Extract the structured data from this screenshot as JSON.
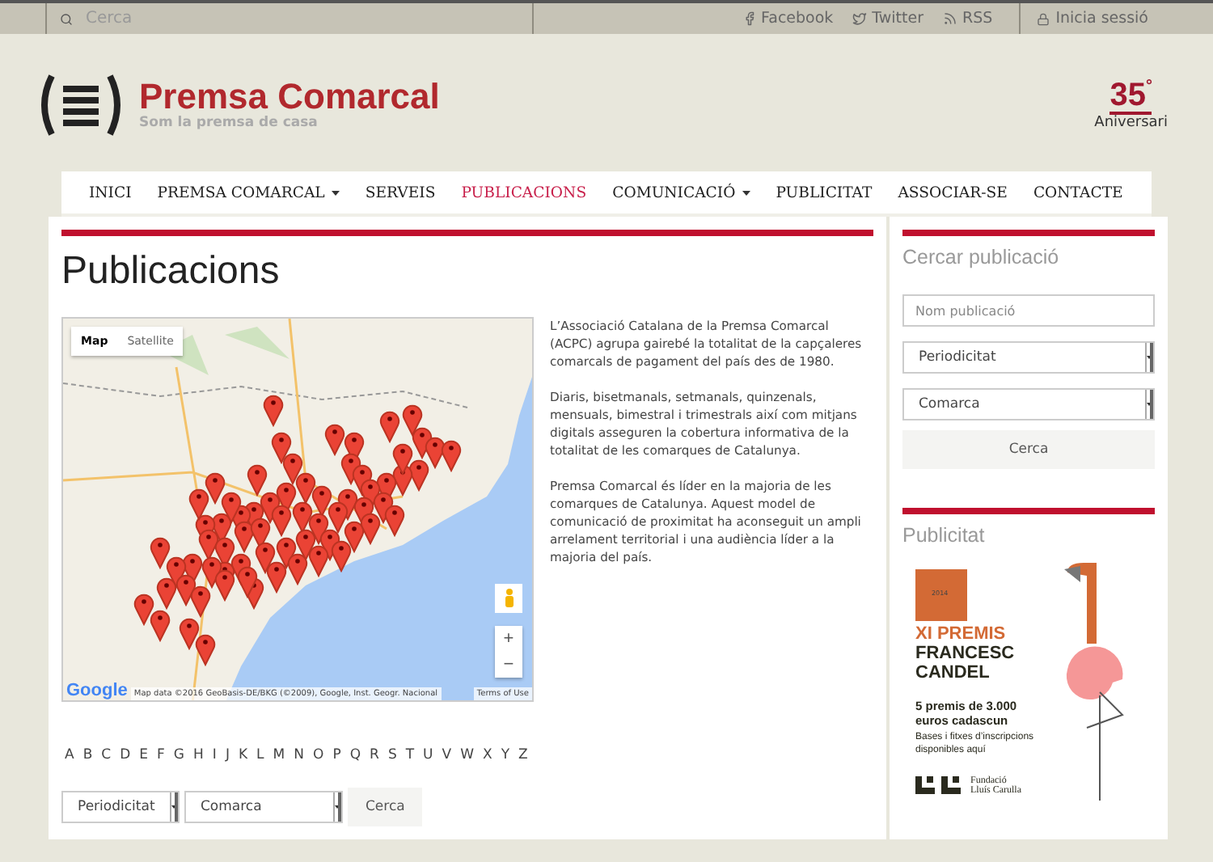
{
  "topbar": {
    "search_placeholder": "Cerca",
    "links": [
      {
        "kind": "facebook",
        "label": "Facebook"
      },
      {
        "kind": "twitter",
        "label": "Twitter"
      },
      {
        "kind": "rss",
        "label": "RSS"
      }
    ],
    "login": "Inicia sessió"
  },
  "logo": {
    "name": "Premsa Comarcal",
    "tagline": "Som la premsa de casa"
  },
  "anniversary": {
    "number": "35",
    "mark": "°",
    "label": "Aniversari"
  },
  "nav": [
    {
      "label": "INICI",
      "selected": false,
      "dropdown": false
    },
    {
      "label": "PREMSA COMARCAL",
      "selected": false,
      "dropdown": true
    },
    {
      "label": "SERVEIS",
      "selected": false,
      "dropdown": false
    },
    {
      "label": "PUBLICACIONS",
      "selected": true,
      "dropdown": false
    },
    {
      "label": "COMUNICACIÓ",
      "selected": false,
      "dropdown": true
    },
    {
      "label": "PUBLICITAT",
      "selected": false,
      "dropdown": false
    },
    {
      "label": "ASSOCIAR-SE",
      "selected": false,
      "dropdown": false
    },
    {
      "label": "CONTACTE",
      "selected": false,
      "dropdown": false
    }
  ],
  "page_title": "Publicacions",
  "map": {
    "types": [
      {
        "label": "Map",
        "selected": true
      },
      {
        "label": "Satellite",
        "selected": false
      }
    ],
    "zoom_in": "+",
    "zoom_out": "−",
    "logo": "Google",
    "attribution": "Map data ©2016 GeoBasis-DE/BKG (©2009), Google, Inst. Geogr. Nacional",
    "terms": "Terms of Use"
  },
  "intro": [
    "L’Associació Catalana de la Premsa Comarcal (ACPC) agrupa gairebé la totalitat de la capçaleres comarcals de pagament del país des de 1980.",
    "Diaris, bisetmanals, setmanals, quinzenals, mensuals, bimestral i trimestrals així com mitjans digitals asseguren la cobertura informativa de la totalitat de les comarques de Catalunya.",
    "Premsa Comarcal és líder en la majoria de les comarques de Catalunya. Aquest model de comunicació de proximitat ha aconseguit un ampli arrelament territorial i una audiència líder a la majoria del país."
  ],
  "letters": [
    "A",
    "B",
    "C",
    "D",
    "E",
    "F",
    "G",
    "H",
    "I",
    "J",
    "K",
    "L",
    "M",
    "N",
    "O",
    "P",
    "Q",
    "R",
    "S",
    "T",
    "U",
    "V",
    "W",
    "X",
    "Y",
    "Z"
  ],
  "filters": {
    "periodicity": "Periodicitat",
    "region": "Comarca",
    "button": "Cerca"
  },
  "sidebar": {
    "search_title": "Cercar publicació",
    "name_placeholder": "Nom publicació",
    "periodicity": "Periodicitat",
    "region": "Comarca",
    "button": "Cerca",
    "ads_title": "Publicitat",
    "ad": {
      "year": "2014",
      "title": "XI PREMIS",
      "subtitle": [
        "FRANCESC",
        "CANDEL"
      ],
      "prize": [
        "5 premis de 3.000",
        "euros cadascun"
      ],
      "info": [
        "Bases i fitxes d’inscripcions",
        "disponibles aquí"
      ],
      "foundation": [
        "Fundació",
        "Lluís Carulla"
      ]
    }
  }
}
